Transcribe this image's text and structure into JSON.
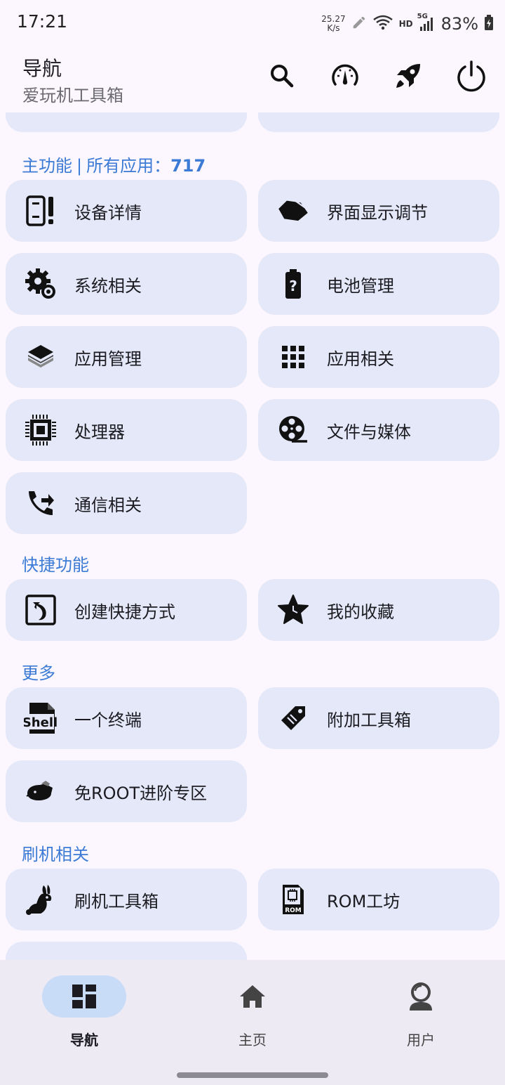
{
  "status": {
    "time": "17:21",
    "net_speed_value": "25.27",
    "net_speed_unit": "K/s",
    "hd": "HD",
    "signal_type": "5G",
    "battery": "83%"
  },
  "appbar": {
    "title": "导航",
    "subtitle": "爱玩机工具箱",
    "actions": [
      "search-icon",
      "speedometer-icon",
      "rocket-icon",
      "power-icon"
    ]
  },
  "sections": {
    "main_title": "主功能",
    "main_sep": "|",
    "main_apps_label": "所有应用：",
    "main_apps_count": "717",
    "shortcuts_title": "快捷功能",
    "more_title": "更多",
    "flash_title": "刷机相关"
  },
  "main_items": [
    {
      "label": "设备详情",
      "icon": "device-info-icon"
    },
    {
      "label": "界面显示调节",
      "icon": "display-adjust-icon"
    },
    {
      "label": "系统相关",
      "icon": "system-gears-icon"
    },
    {
      "label": "电池管理",
      "icon": "battery-unknown-icon"
    },
    {
      "label": "应用管理",
      "icon": "layers-icon"
    },
    {
      "label": "应用相关",
      "icon": "apps-grid-icon"
    },
    {
      "label": "处理器",
      "icon": "cpu-chip-icon"
    },
    {
      "label": "文件与媒体",
      "icon": "film-reel-icon"
    },
    {
      "label": "通信相关",
      "icon": "phone-forward-icon"
    }
  ],
  "shortcut_items": [
    {
      "label": "创建快捷方式",
      "icon": "shortcut-arrow-icon"
    },
    {
      "label": "我的收藏",
      "icon": "star-icon"
    }
  ],
  "more_items": [
    {
      "label": "一个终端",
      "icon": "shell-file-icon",
      "icon_text": "Shell"
    },
    {
      "label": "附加工具箱",
      "icon": "tag-icon"
    },
    {
      "label": "免ROOT进阶专区",
      "icon": "boar-icon"
    }
  ],
  "flash_items": [
    {
      "label": "刷机工具箱",
      "icon": "rabbit-icon"
    },
    {
      "label": "ROM工坊",
      "icon": "rom-chip-icon",
      "icon_text": "ROM"
    }
  ],
  "bottom_nav": [
    {
      "label": "导航",
      "icon": "dashboard-icon",
      "active": true
    },
    {
      "label": "主页",
      "icon": "home-icon",
      "active": false
    },
    {
      "label": "用户",
      "icon": "user-icon",
      "active": false
    }
  ]
}
